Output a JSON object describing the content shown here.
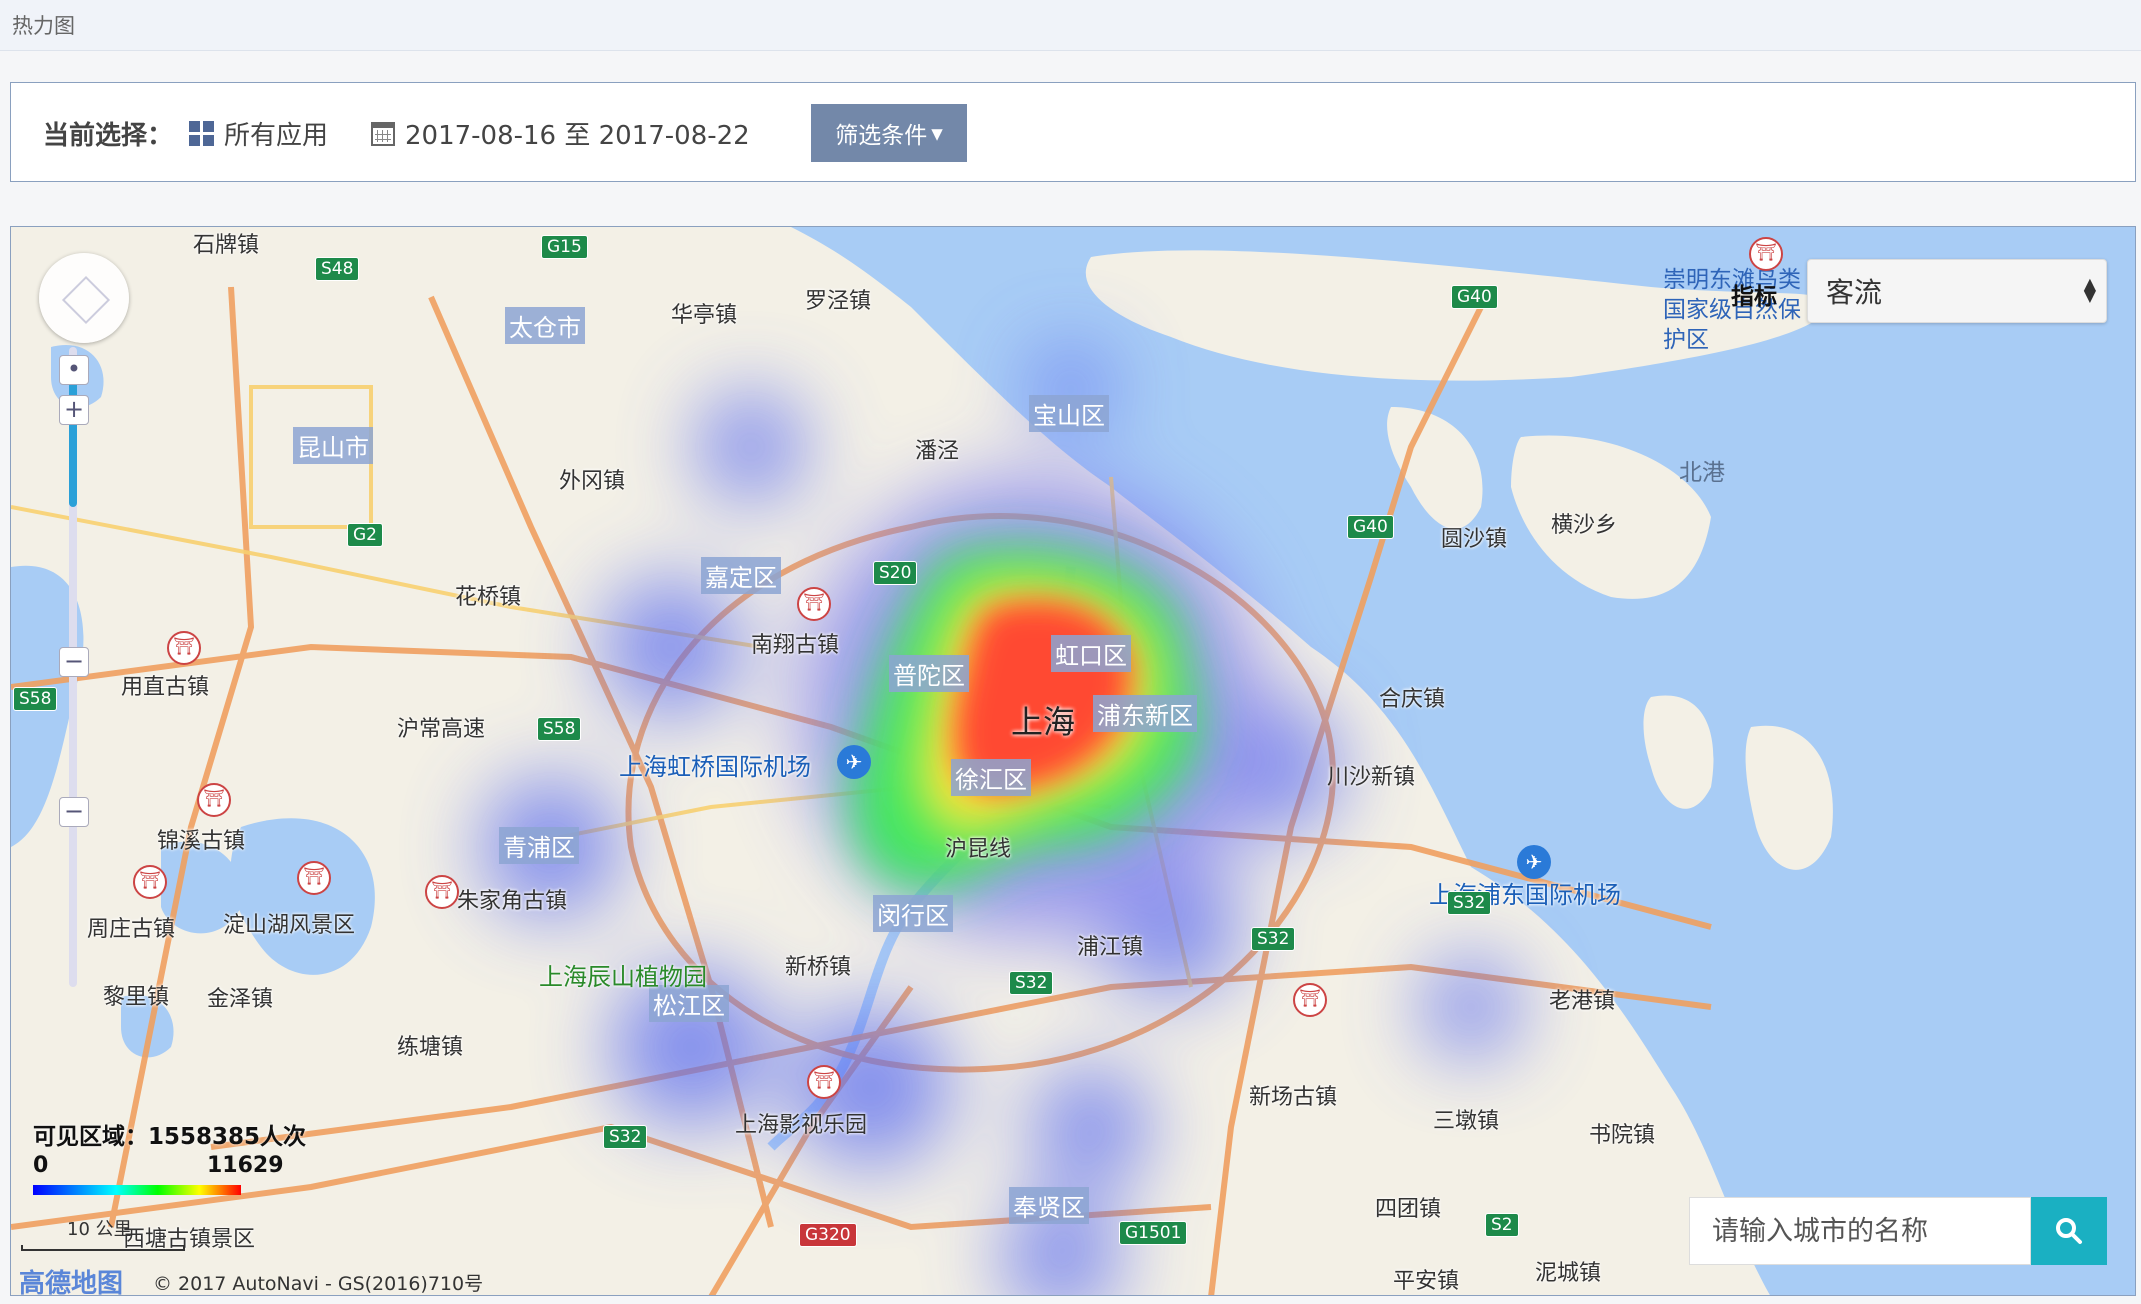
{
  "page_title": "热力图",
  "filter": {
    "label": "当前选择：",
    "apps": "所有应用",
    "date_range": "2017-08-16 至 2017-08-22",
    "button_label": "筛选条件"
  },
  "map": {
    "indicator_label": "指标",
    "indicator_value": "客流",
    "visible_area_text": "可见区域：1558385人次",
    "legend_min": "0",
    "legend_max": "11629",
    "scale_label": "10 公里",
    "logo": "高德地图",
    "copyright": "© 2017 AutoNavi - GS(2016)710号",
    "search_placeholder": "请输入城市的名称",
    "city": "上海",
    "districts": [
      "嘉定区",
      "宝山区",
      "普陀区",
      "虹口区",
      "浦东新区",
      "徐汇区",
      "闵行区",
      "青浦区",
      "松江区",
      "奉贤区",
      "太仓市",
      "昆山市"
    ],
    "towns": [
      "石牌镇",
      "华亭镇",
      "罗泾镇",
      "外冈镇",
      "花桥镇",
      "南翔古镇",
      "用直古镇",
      "锦溪古镇",
      "周庄古镇",
      "淀山湖风景区",
      "朱家角古镇",
      "黎里镇",
      "金泽镇",
      "练塘镇",
      "新桥镇",
      "浦江镇",
      "上海影视乐园",
      "新场古镇",
      "三墩镇",
      "书院镇",
      "老港镇",
      "四团镇",
      "平安镇",
      "泥城镇",
      "西塘古镇景区",
      "合庆镇",
      "川沙新镇",
      "圆沙镇",
      "横沙乡",
      "沪常高速",
      "沪昆线",
      "潘泾"
    ],
    "airports": [
      "上海虹桥国际机场",
      "上海浦东国际机场"
    ],
    "park": "上海辰山植物园",
    "reserve": "崇明东滩鸟类国家级自然保护区",
    "sea_label": "北港",
    "highways": [
      "G15",
      "S48",
      "G2",
      "S20",
      "S58",
      "G40",
      "G40",
      "S32",
      "S32",
      "S32",
      "S32",
      "S2",
      "G1501",
      "G320",
      "S58"
    ]
  }
}
